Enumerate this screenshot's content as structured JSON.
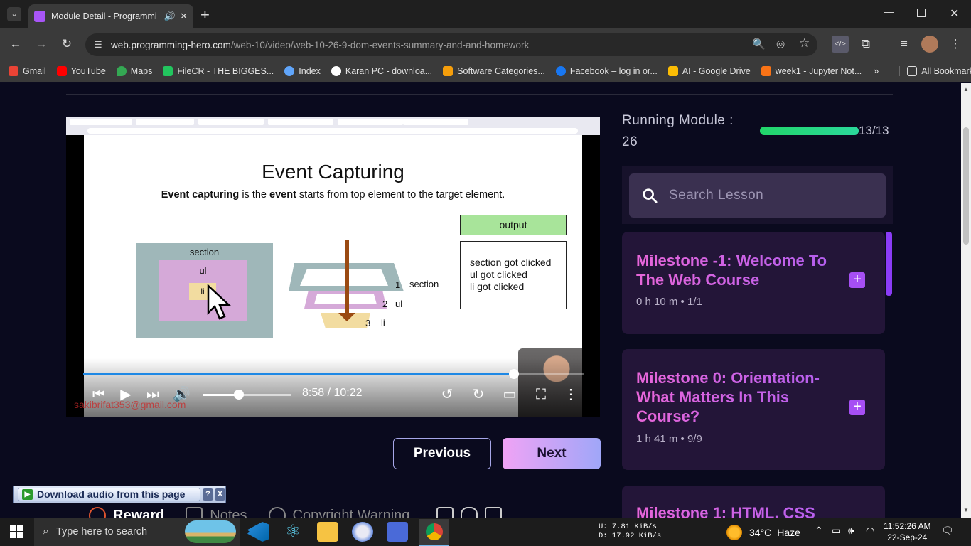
{
  "browser": {
    "tab_title": "Module Detail - Programmi",
    "url_host": "web.programming-hero.com",
    "url_path": "/web-10/video/web-10-26-9-dom-events-summary-and-and-homework",
    "bookmarks": [
      {
        "label": "Gmail",
        "color": "#ea4335"
      },
      {
        "label": "YouTube",
        "color": "#ff0000"
      },
      {
        "label": "Maps",
        "color": "#34a853"
      },
      {
        "label": "FileCR - THE BIGGES...",
        "color": "#22c55e"
      },
      {
        "label": "Index",
        "color": "#60a5fa"
      },
      {
        "label": "Karan PC - downloa...",
        "color": "#ffffff"
      },
      {
        "label": "Software Categories...",
        "color": "#f59e0b"
      },
      {
        "label": "Facebook – log in or...",
        "color": "#1877f2"
      },
      {
        "label": "AI - Google Drive",
        "color": "#fbbc04"
      },
      {
        "label": "week1 - Jupyter Not...",
        "color": "#f97316"
      }
    ],
    "all_bookmarks": "All Bookmarks"
  },
  "video": {
    "slide_title": "Event Capturing",
    "slide_subtitle_parts": [
      "Event capturing",
      " is the ",
      "event",
      " starts from top element to the target element."
    ],
    "diagram": {
      "section": "section",
      "ul": "ul",
      "li": "li",
      "layers": [
        {
          "num": "1",
          "label": "section"
        },
        {
          "num": "2",
          "label": "ul"
        },
        {
          "num": "3",
          "label": "li"
        }
      ]
    },
    "output_label": "output",
    "output_lines": [
      "section got clicked",
      "ul got clicked",
      "li got clicked"
    ],
    "time": "8:58 / 10:22",
    "progress": 0.859,
    "volume": 0.41,
    "watermark": "sakibrifat353@gmail.com"
  },
  "nav": {
    "previous": "Previous",
    "next": "Next"
  },
  "below_tabs": [
    "Reward",
    "Notes",
    "Copyright Warning"
  ],
  "extension": {
    "label": "Download audio from this page",
    "help": "?",
    "close": "X"
  },
  "sidebar": {
    "running_label": "Running Module :",
    "running_number": "26",
    "progress_text": "13/13",
    "progress": 1.0,
    "search_placeholder": "Search Lesson",
    "milestones": [
      {
        "title": "Milestone -1: Welcome To The Web Course",
        "duration": "0 h 10 m",
        "count": "1/1"
      },
      {
        "title": "Milestone 0: Orientation- What Matters In This Course?",
        "duration": "1 h 41 m",
        "count": "9/9"
      },
      {
        "title": "Milestone 1: HTML, CSS",
        "duration": "",
        "count": ""
      }
    ]
  },
  "taskbar": {
    "search_placeholder": "Type here to search",
    "net_up": "U:       7.81 KiB/s",
    "net_down": "D:      17.92 KiB/s",
    "temperature": "34°C",
    "weather": "Haze",
    "time": "11:52:26 AM",
    "date": "22-Sep-24"
  }
}
